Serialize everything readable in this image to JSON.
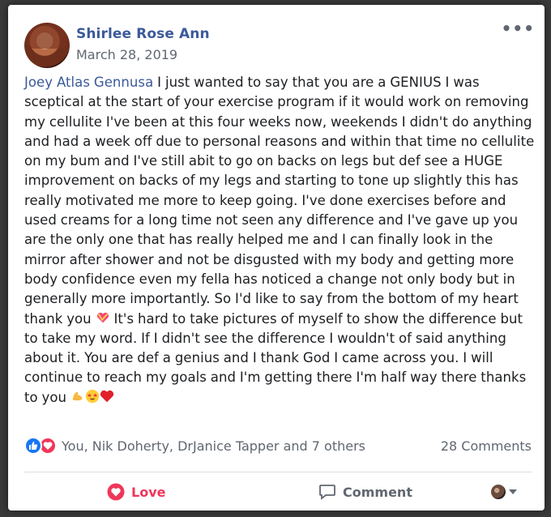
{
  "post": {
    "author": "Shirlee Rose Ann",
    "date": "March 28, 2019",
    "more_label": "•••",
    "mention": "Joey Atlas Gennusa",
    "body_part1": " I just wanted to say that you are a GENIUS I was sceptical at the start of your exercise program if it would work on removing my cellulite I've been at this four weeks now, weekends I didn't do anything and had a week off due to personal reasons and within that time no cellulite on my bum and I've still abit to go on backs on legs but def see a HUGE improvement on backs of my legs and starting to tone up slightly this has really motivated me more to keep going. I've done exercises before and used creams for a long time not seen any difference and I've gave up you are the only one that has really helped me and I can finally look in the mirror after shower and not be disgusted with my body and getting more body confidence even my fella has noticed a change not only body but in generally more importantly. So I'd like to say from the bottom of my heart thank you",
    "body_part2": " It's hard to take pictures of myself to show the difference but to take my word. If I didn't see the difference I wouldn't of said anything about it. You are def a genius and I thank God I came across you. I will continue to reach my goals and I'm getting there I'm half way there thanks to you",
    "emoji_heart_gift": "sparkling-heart-emoji",
    "emoji_end": [
      "flexed-biceps-emoji",
      "star-struck-emoji",
      "red-heart-emoji"
    ]
  },
  "reactions": {
    "icons": [
      "like-icon",
      "love-icon"
    ],
    "summary": "You, Nik Doherty, DrJanice Tapper and 7 others",
    "comments": "28 Comments"
  },
  "actions": {
    "love_label": "Love",
    "comment_label": "Comment"
  },
  "colors": {
    "link": "#3b5a9a",
    "love": "#f0365b",
    "like": "#1877f2",
    "secondary_text": "#606770"
  }
}
